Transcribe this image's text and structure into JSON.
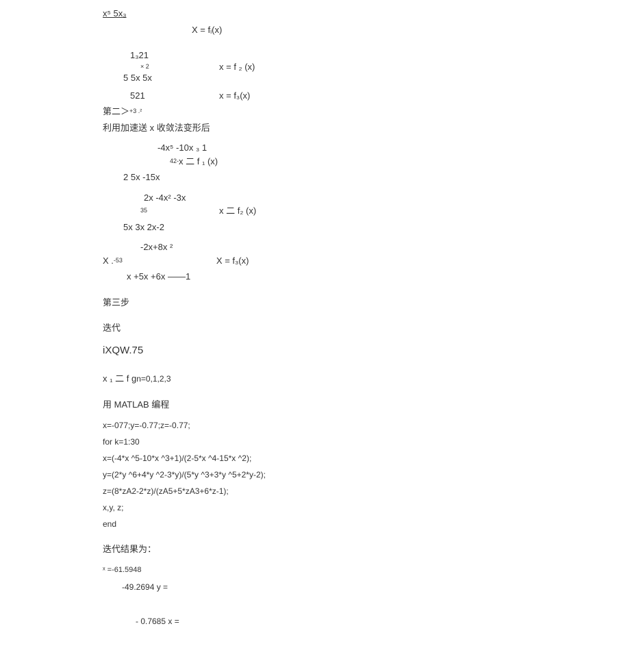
{
  "header": {
    "expr": "x⁵ 5x₃"
  },
  "eqs": {
    "e1_rhs": "X = fᵢ(x)",
    "e2_line1": "1₃21",
    "e2_line2": "× 2",
    "e2_line3": "5 5x 5x",
    "e2_rhs": "x = f ₂ (x)",
    "e3_line1": "521",
    "e3_rhs": "x = f₃(x)"
  },
  "step2": {
    "title_a": "第二＞",
    "title_b": "+3 .²",
    "desc": "利用加速送 x 收敛法变形后",
    "g1_line1": "-4x⁵ -10x ₃ 1",
    "g1_line2a": "42-",
    "g1_line2b": " x 二  f ₁ (x)",
    "g1_line3": "2 5x -15x",
    "g2_line1": "2x -4x² -3x",
    "g2_line2a": "35",
    "g2_line2b": "x 二  f₂ (x)",
    "g2_line3": "5x 3x 2x-2",
    "g3_line1": "-2x+8x ²",
    "g3_line2a": "X . ",
    "g3_line2b": "-53",
    "g3_rhs": "X = f₃(x)",
    "g3_line3": "x +5x +6x ——1"
  },
  "step3": {
    "title": "第三步",
    "sub1": "迭代",
    "sub2": "iXQW.75",
    "iter_a": "x ₁ 二  f g ",
    "iter_b": "n=0,1,2,3"
  },
  "matlab": {
    "title": "用 MATLAB 编程",
    "l1": "x=-077;y=-0.77;z=-0.77;",
    "l2": "for k=1:30",
    "l3": "x=(-4*x ^5-10*x ^3+1)/(2-5*x ^4-15*x ^2);",
    "l4": "y=(2*y ^6+4*y ^2-3*y)/(5*y ^3+3*y ^5+2*y-2);",
    "l5": "z=(8*zA2-2*z)/(zA5+5*zA3+6*z-1);",
    "l6": "x,y, z;",
    "l7": "end"
  },
  "results": {
    "title": "迭代结果为：",
    "r1": "ˣ =-61.5948",
    "r2": "-49.2694 y =",
    "r3": "-  0.7685 x ="
  }
}
